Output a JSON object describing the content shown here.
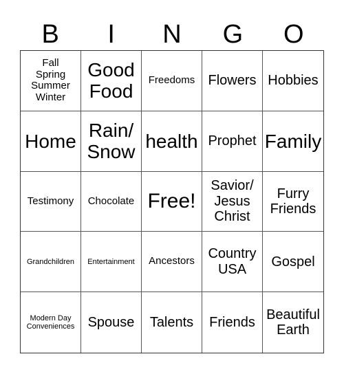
{
  "header": {
    "letters": [
      "B",
      "I",
      "N",
      "G",
      "O"
    ]
  },
  "cells": [
    {
      "text": "Fall\nSpring\nSummer\nWinter",
      "size": "s2"
    },
    {
      "text": "Good Food",
      "size": "s4"
    },
    {
      "text": "Freedoms",
      "size": "s2"
    },
    {
      "text": "Flowers",
      "size": "s3"
    },
    {
      "text": "Hobbies",
      "size": "s3"
    },
    {
      "text": "Home",
      "size": "s4"
    },
    {
      "text": "Rain/ Snow",
      "size": "s4"
    },
    {
      "text": "health",
      "size": "s4"
    },
    {
      "text": "Prophet",
      "size": "s3"
    },
    {
      "text": "Family",
      "size": "s4"
    },
    {
      "text": "Testimony",
      "size": "s2"
    },
    {
      "text": "Chocolate",
      "size": "s2"
    },
    {
      "text": "Free!",
      "size": "s5"
    },
    {
      "text": "Savior/ Jesus Christ",
      "size": "s3"
    },
    {
      "text": "Furry Friends",
      "size": "s3"
    },
    {
      "text": "Grandchildren",
      "size": "s1"
    },
    {
      "text": "Entertainment",
      "size": "s1"
    },
    {
      "text": "Ancestors",
      "size": "s2"
    },
    {
      "text": "Country USA",
      "size": "s3"
    },
    {
      "text": "Gospel",
      "size": "s3"
    },
    {
      "text": "Modern Day Conveniences",
      "size": "s1"
    },
    {
      "text": "Spouse",
      "size": "s3"
    },
    {
      "text": "Talents",
      "size": "s3"
    },
    {
      "text": "Friends",
      "size": "s3"
    },
    {
      "text": "Beautiful Earth",
      "size": "s3"
    }
  ]
}
